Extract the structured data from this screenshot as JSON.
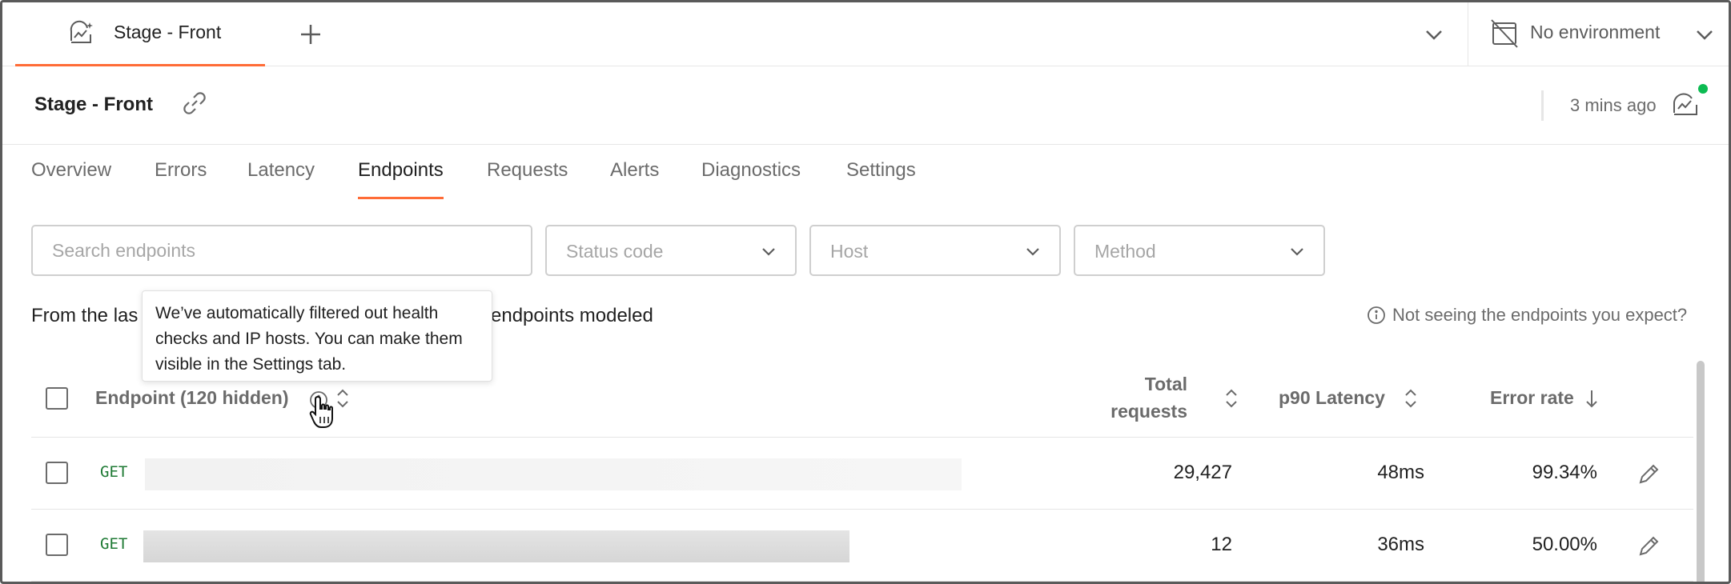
{
  "tabbar": {
    "active_tab_label": "Stage - Front",
    "active_tab_icon": "monitor-icon",
    "accent_color": "#ff6c37",
    "environment_label": "No environment"
  },
  "header": {
    "title": "Stage - Front",
    "updated": "3 mins ago",
    "status_color": "#0cbb52"
  },
  "subtabs": [
    "Overview",
    "Errors",
    "Latency",
    "Endpoints",
    "Requests",
    "Alerts",
    "Diagnostics",
    "Settings"
  ],
  "active_subtab": "Endpoints",
  "filters": {
    "search_placeholder": "Search endpoints",
    "status_code": "Status code",
    "host": "Host",
    "method": "Method"
  },
  "summary": {
    "left_text": "From the las",
    "right_text": "endpoints modeled",
    "help_text": "Not seeing the endpoints you expect?"
  },
  "tooltip": {
    "text": "We’ve automatically filtered out health checks and IP hosts. You can make them visible in the Settings tab."
  },
  "table": {
    "columns": {
      "endpoint": "Endpoint (120 hidden)",
      "total_requests_line1": "Total",
      "total_requests_line2": "requests",
      "p90_latency": "p90 Latency",
      "error_rate": "Error rate"
    },
    "rows": [
      {
        "method": "GET",
        "total_requests": "29,427",
        "p90_latency": "48ms",
        "error_rate": "99.34%"
      },
      {
        "method": "GET",
        "total_requests": "12",
        "p90_latency": "36ms",
        "error_rate": "50.00%"
      }
    ]
  }
}
